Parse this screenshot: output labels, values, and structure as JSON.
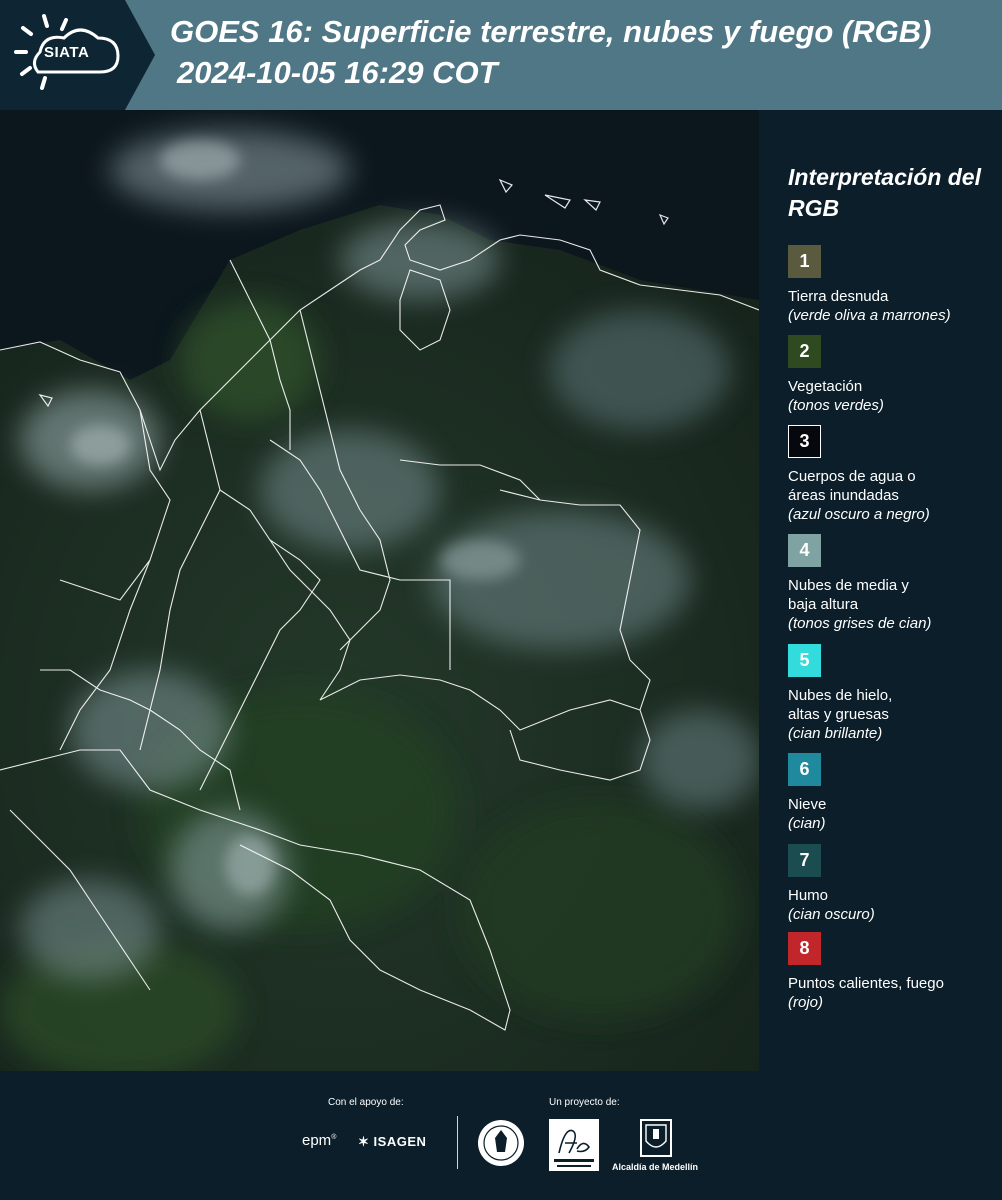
{
  "header": {
    "logo_text": "SIATA",
    "title_line1": "GOES 16: Superficie terrestre, nubes y fuego (RGB)",
    "title_line2": "2024-10-05 16:29 COT"
  },
  "legend": {
    "title": "Interpretación del RGB",
    "items": [
      {
        "number": "1",
        "label": "Tierra desnuda",
        "note": "(verde oliva a marrones)",
        "color": "#5a5a3e"
      },
      {
        "number": "2",
        "label": "Vegetación",
        "note": "(tonos verdes)",
        "color": "#2f4a20"
      },
      {
        "number": "3",
        "label": "Cuerpos de agua o\náreas inundadas",
        "note": "(azul oscuro a negro)",
        "color": "#05080c"
      },
      {
        "number": "4",
        "label": "Nubes de media y\nbaja altura",
        "note": "(tonos grises de cian)",
        "color": "#7fa3a3"
      },
      {
        "number": "5",
        "label": "Nubes de hielo,\naltas y gruesas",
        "note": "(cian brillante)",
        "color": "#33dcdc"
      },
      {
        "number": "6",
        "label": "Nieve",
        "note": "(cian)",
        "color": "#1f8a9e"
      },
      {
        "number": "7",
        "label": "Humo",
        "note": "(cian oscuro)",
        "color": "#1b4d50"
      },
      {
        "number": "8",
        "label": "Puntos calientes, fuego",
        "note": "(rojo)",
        "color": "#c0262a"
      }
    ]
  },
  "footer": {
    "support_caption": "Con el apoyo de:",
    "project_caption": "Un proyecto de:",
    "epm_label": "epm",
    "isagen_label": "ISAGEN",
    "alcaldia_label": "Alcaldía de Medellín"
  },
  "colors": {
    "header_bg": "#4f7786",
    "page_bg": "#0b1e29",
    "boundary_lines": "#ffffff"
  }
}
